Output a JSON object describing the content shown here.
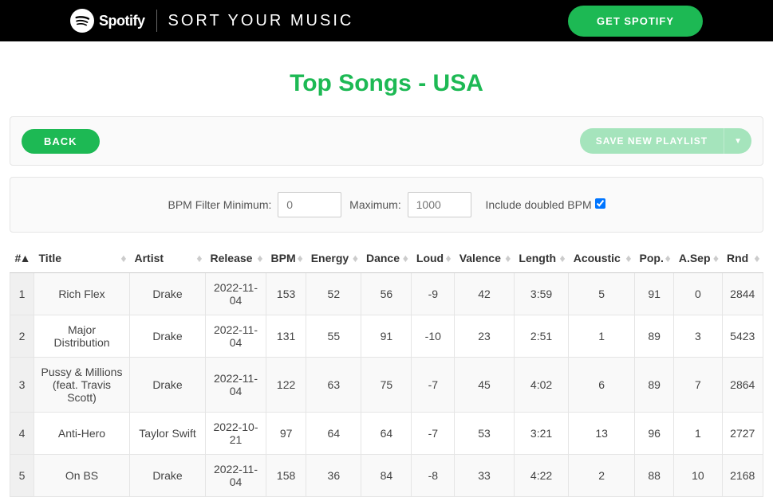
{
  "header": {
    "brand": "Spotify",
    "app_name": "SORT YOUR MUSIC",
    "cta": "GET SPOTIFY"
  },
  "page": {
    "title": "Top Songs - USA",
    "back_label": "BACK",
    "save_label": "SAVE NEW PLAYLIST"
  },
  "filter": {
    "min_label": "BPM Filter Minimum:",
    "min_placeholder": "0",
    "max_label": "Maximum:",
    "max_placeholder": "1000",
    "doubled_label": "Include doubled BPM",
    "doubled_checked": true
  },
  "columns": [
    "#",
    "Title",
    "Artist",
    "Release",
    "BPM",
    "Energy",
    "Dance",
    "Loud",
    "Valence",
    "Length",
    "Acoustic",
    "Pop.",
    "A.Sep",
    "Rnd"
  ],
  "rows": [
    {
      "n": "1",
      "title": "Rich Flex",
      "artist": "Drake",
      "release": "2022-11-04",
      "bpm": "153",
      "energy": "52",
      "dance": "56",
      "loud": "-9",
      "valence": "42",
      "length": "3:59",
      "acoustic": "5",
      "pop": "91",
      "asep": "0",
      "rnd": "2844"
    },
    {
      "n": "2",
      "title": "Major Distribution",
      "artist": "Drake",
      "release": "2022-11-04",
      "bpm": "131",
      "energy": "55",
      "dance": "91",
      "loud": "-10",
      "valence": "23",
      "length": "2:51",
      "acoustic": "1",
      "pop": "89",
      "asep": "3",
      "rnd": "5423"
    },
    {
      "n": "3",
      "title": "Pussy & Millions (feat. Travis Scott)",
      "artist": "Drake",
      "release": "2022-11-04",
      "bpm": "122",
      "energy": "63",
      "dance": "75",
      "loud": "-7",
      "valence": "45",
      "length": "4:02",
      "acoustic": "6",
      "pop": "89",
      "asep": "7",
      "rnd": "2864"
    },
    {
      "n": "4",
      "title": "Anti-Hero",
      "artist": "Taylor Swift",
      "release": "2022-10-21",
      "bpm": "97",
      "energy": "64",
      "dance": "64",
      "loud": "-7",
      "valence": "53",
      "length": "3:21",
      "acoustic": "13",
      "pop": "96",
      "asep": "1",
      "rnd": "2727"
    },
    {
      "n": "5",
      "title": "On BS",
      "artist": "Drake",
      "release": "2022-11-04",
      "bpm": "158",
      "energy": "36",
      "dance": "84",
      "loud": "-8",
      "valence": "33",
      "length": "4:22",
      "acoustic": "2",
      "pop": "88",
      "asep": "10",
      "rnd": "2168"
    }
  ]
}
